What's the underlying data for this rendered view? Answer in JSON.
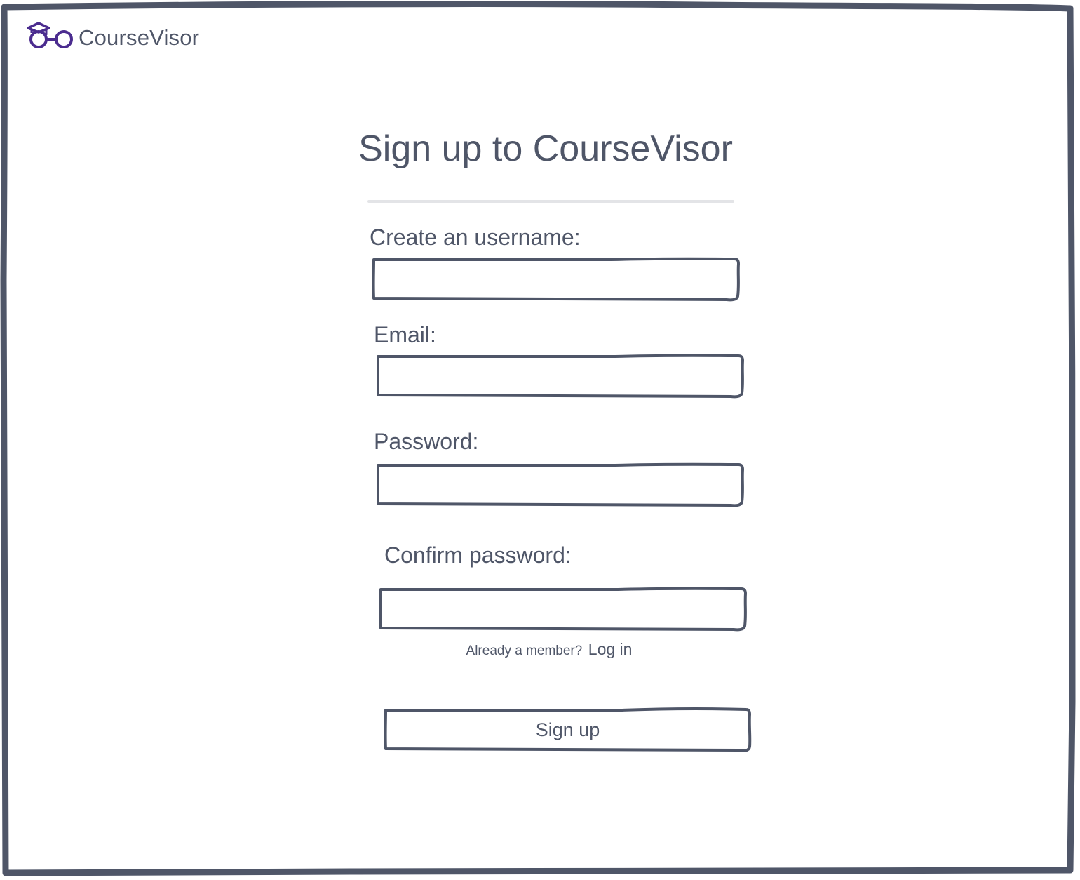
{
  "brand": {
    "name": "CourseVisor",
    "icon": "graduation-cap-glasses-icon",
    "accent_color": "#4b2c8f"
  },
  "page": {
    "title": "Sign up to CourseVisor"
  },
  "form": {
    "username_label": "Create an username:",
    "username_value": "",
    "email_label": "Email:",
    "email_value": "",
    "password_label": "Password:",
    "password_value": "",
    "confirm_label": "Confirm password:",
    "confirm_value": ""
  },
  "login": {
    "prompt": "Already a member?",
    "link_label": "Log in"
  },
  "submit": {
    "label": "Sign up"
  },
  "colors": {
    "ink": "#4f5668",
    "divider": "#e3e4e7"
  }
}
